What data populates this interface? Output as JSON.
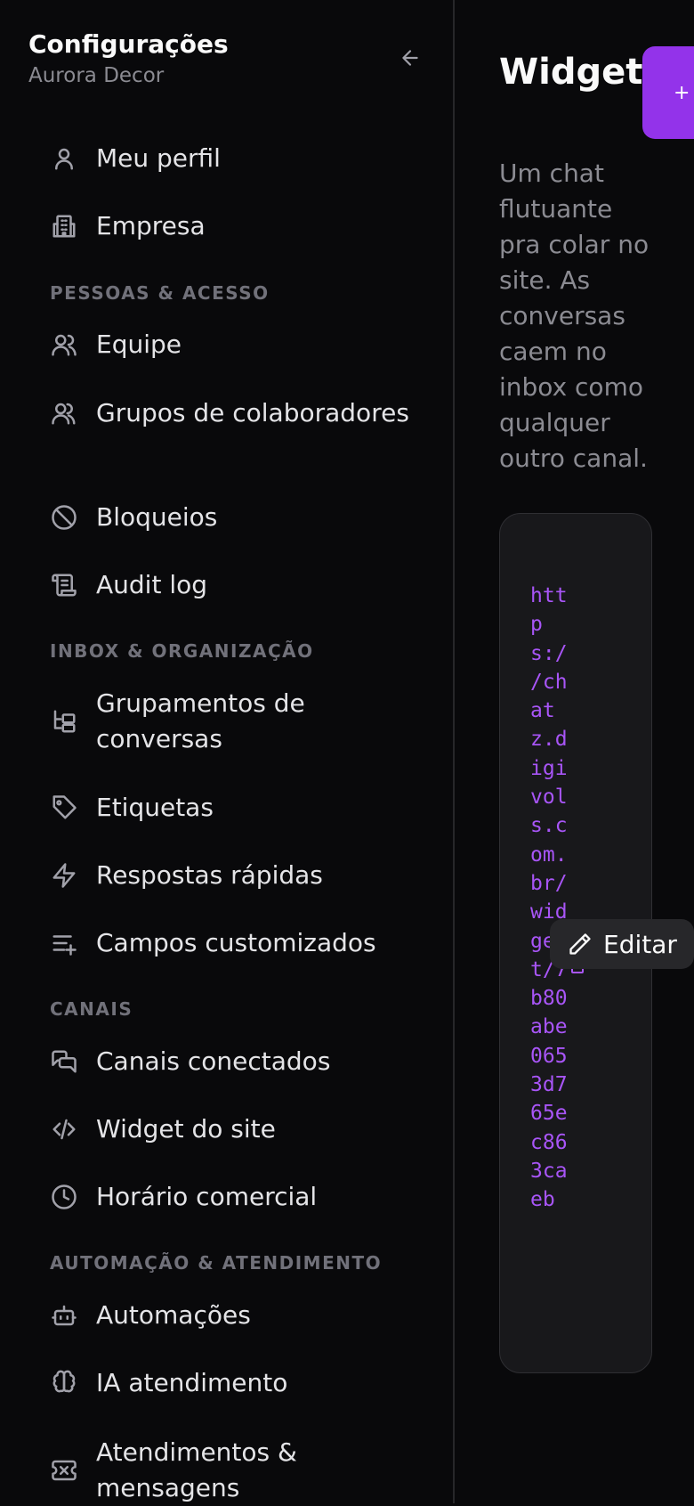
{
  "header": {
    "title": "Configurações",
    "subtitle": "Aurora Decor"
  },
  "sidebar": {
    "items": [
      {
        "label": "Meu perfil",
        "icon": "user-icon"
      },
      {
        "label": "Empresa",
        "icon": "building-icon"
      },
      {
        "label": "Equipe",
        "icon": "users-icon"
      },
      {
        "label": "Grupos de colaboradores",
        "icon": "users-group-icon"
      },
      {
        "label": "Bloqueios",
        "icon": "ban-icon"
      },
      {
        "label": "Audit log",
        "icon": "scroll-icon"
      },
      {
        "label": "Grupamentos de conversas",
        "icon": "folder-tree-icon"
      },
      {
        "label": "Etiquetas",
        "icon": "tag-icon"
      },
      {
        "label": "Respostas rápidas",
        "icon": "zap-icon"
      },
      {
        "label": "Campos customizados",
        "icon": "list-plus-icon"
      },
      {
        "label": "Canais conectados",
        "icon": "messages-icon"
      },
      {
        "label": "Widget do site",
        "icon": "code-icon"
      },
      {
        "label": "Horário comercial",
        "icon": "clock-icon"
      },
      {
        "label": "Automações",
        "icon": "bot-icon"
      },
      {
        "label": "IA atendimento",
        "icon": "brain-icon"
      },
      {
        "label": "Atendimentos & mensagens",
        "icon": "ticket-icon"
      }
    ],
    "sections": [
      {
        "label": "PESSOAS & ACESSO"
      },
      {
        "label": "INBOX & ORGANIZAÇÃO"
      },
      {
        "label": "CANAIS"
      },
      {
        "label": "AUTOMAÇÃO & ATENDIMENTO"
      }
    ]
  },
  "main": {
    "title": "Widget do site",
    "description": "Um chat flutuante pra colar no site. As conversas caem no inbox como qualquer outro canal.",
    "add_label": "+",
    "widget_url": "https://chatz.digivols.com.br/widget/7b80abe0653d765ec863caeb",
    "edit_label": "Editar"
  },
  "colors": {
    "accent": "#9333ea",
    "code": "#a855f7",
    "background": "#09090b"
  }
}
